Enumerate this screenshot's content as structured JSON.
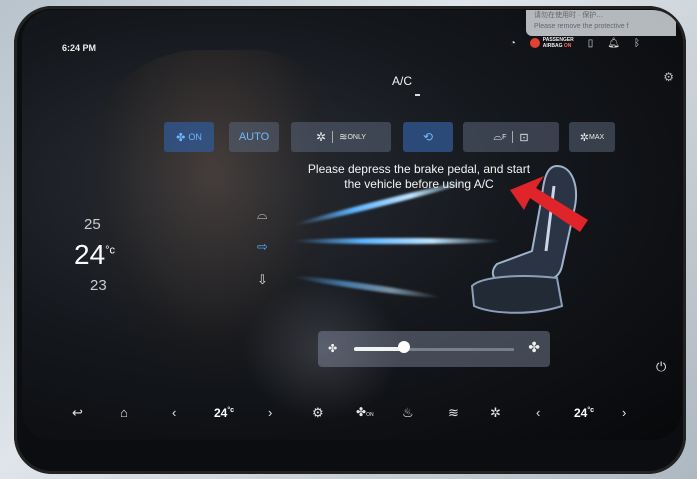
{
  "status_bar": {
    "time": "6:24 PM",
    "airbag_line1": "PASSENGER",
    "airbag_line2": "AIRBAG",
    "airbag_state": "ON",
    "sticker_line1": "请勿在使用时 · 保护…",
    "sticker_line2": "Please remove the protective f"
  },
  "header": {
    "title": "A/C"
  },
  "controls": {
    "fan_on": "ON",
    "auto": "AUTO",
    "only": "ONLY",
    "front_defrost": "F",
    "max": "MAX"
  },
  "message": "Please depress the brake pedal, and start the vehicle before using A/C",
  "temperature": {
    "upper": "25",
    "current": "24",
    "unit": "°c",
    "lower": "23"
  },
  "fan_speed": {
    "level_fraction": 0.25
  },
  "bottom_bar": {
    "left_temp": "24",
    "left_unit": "°c",
    "fan_on": "ON",
    "right_temp": "24",
    "right_unit": "°c"
  },
  "colors": {
    "accent": "#4ea7ff",
    "active_bg": "#2f5b96",
    "airbag_red": "#e4402f",
    "annotation_arrow": "#e0242a"
  }
}
